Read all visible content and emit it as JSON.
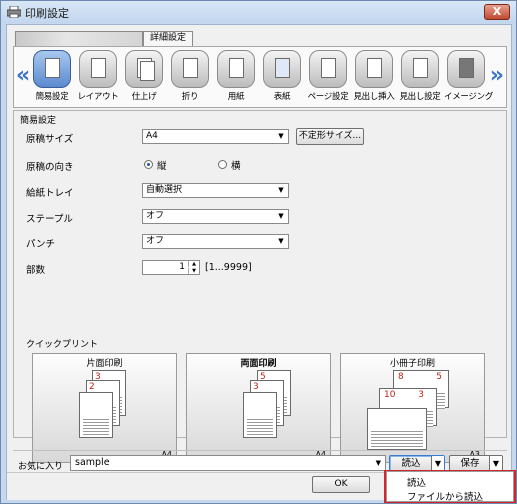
{
  "window": {
    "title": "印刷設定",
    "close_label": "X"
  },
  "tabs": [
    {
      "label": ""
    },
    {
      "label": "詳細設定"
    }
  ],
  "iconbar": {
    "items": [
      {
        "label": "簡易設定",
        "icon": "quick-setting-icon"
      },
      {
        "label": "レイアウト",
        "icon": "layout-icon"
      },
      {
        "label": "仕上げ",
        "icon": "finishing-icon"
      },
      {
        "label": "折り",
        "icon": "fold-icon"
      },
      {
        "label": "用紙",
        "icon": "paper-icon"
      },
      {
        "label": "表紙",
        "icon": "cover-icon"
      },
      {
        "label": "ページ設定",
        "icon": "page-setting-icon"
      },
      {
        "label": "見出し挿入",
        "icon": "tab-insert-icon"
      },
      {
        "label": "見出し設定",
        "icon": "tab-setting-icon"
      },
      {
        "label": "イメージング",
        "icon": "imaging-icon"
      }
    ]
  },
  "simple": {
    "section_title": "簡易設定",
    "original_size_label": "原稿サイズ",
    "original_size_value": "A4",
    "custom_size_button": "不定形サイズ...",
    "orientation_label": "原稿の向き",
    "orientation_portrait": "縦",
    "orientation_landscape": "横",
    "tray_label": "給紙トレイ",
    "tray_value": "自動選択",
    "staple_label": "ステープル",
    "staple_value": "オフ",
    "punch_label": "パンチ",
    "punch_value": "オフ",
    "copies_label": "部数",
    "copies_value": "1",
    "copies_range": "[1...9999]"
  },
  "quick_print": {
    "title": "クイックプリント",
    "options": [
      {
        "label": "片面印刷",
        "size": "A4"
      },
      {
        "label": "両面印刷",
        "size": "A4"
      },
      {
        "label": "小冊子印刷",
        "size": "A3"
      }
    ]
  },
  "favorites": {
    "label": "お気に入り",
    "value": "sample",
    "load_button": "読込",
    "save_button": "保存"
  },
  "footer": {
    "ok_button": "OK"
  },
  "load_menu": {
    "items": [
      {
        "label": "読込"
      },
      {
        "label": "ファイルから読込"
      }
    ]
  }
}
